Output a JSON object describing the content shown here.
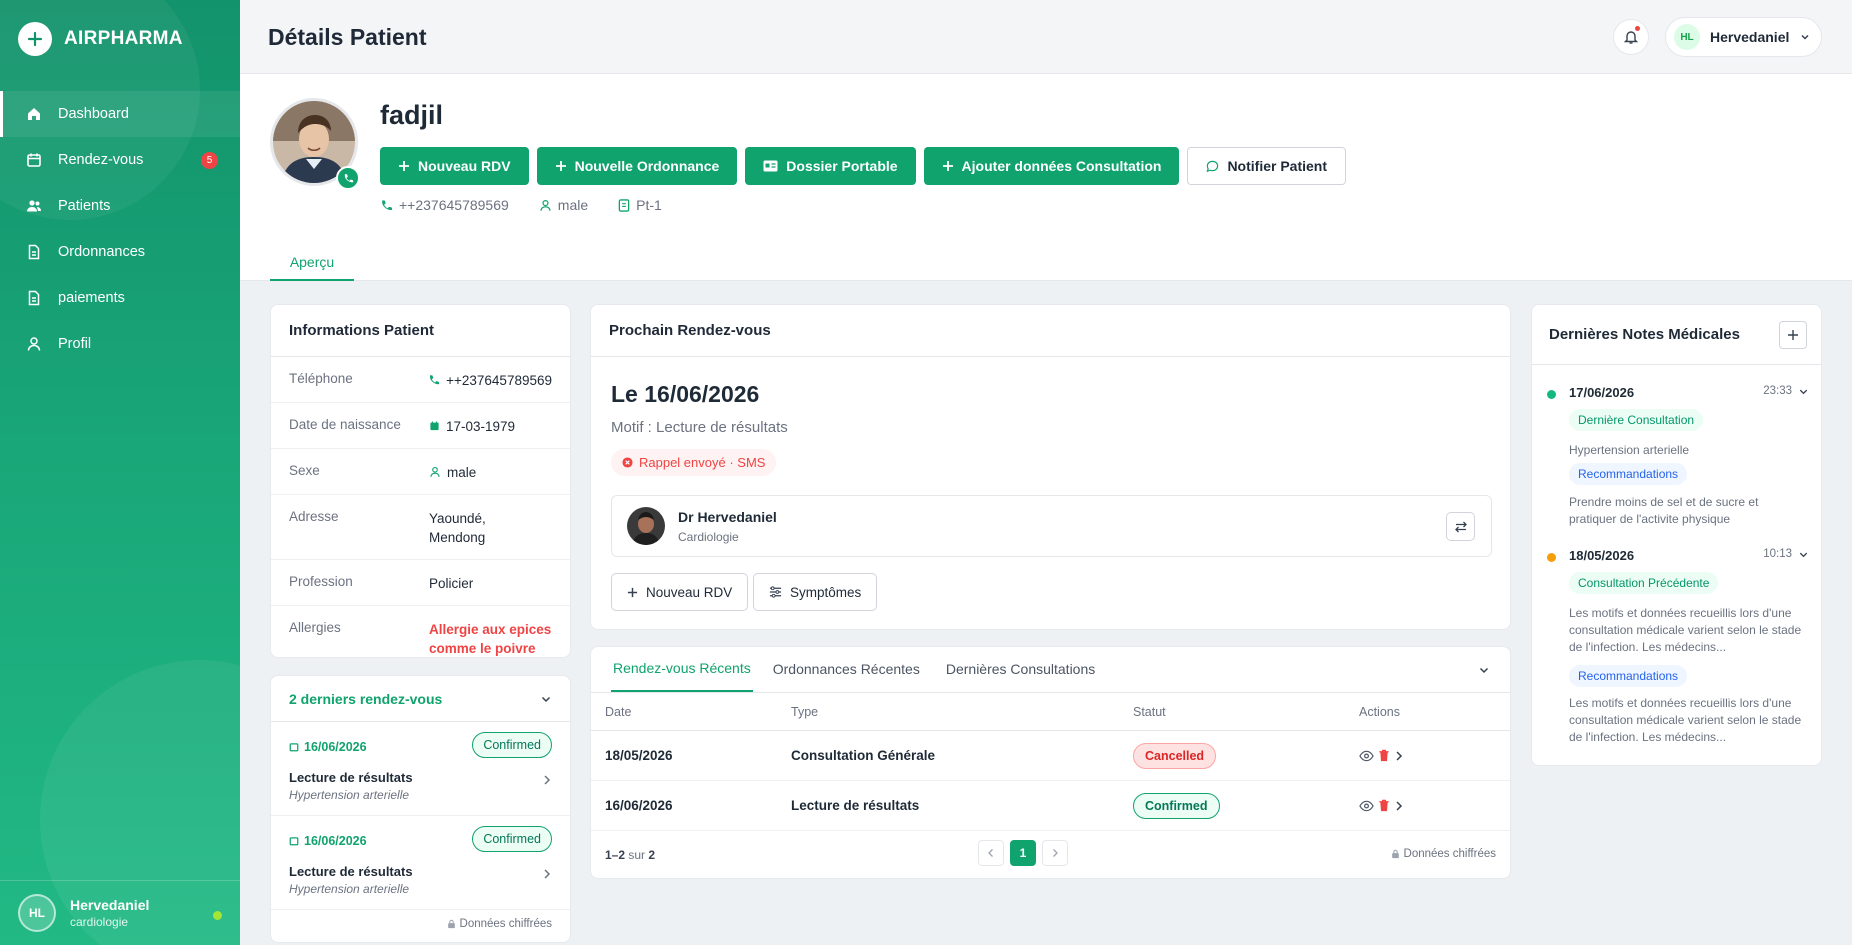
{
  "app": {
    "brand": "AIRPHARMA"
  },
  "sidebar": {
    "items": [
      {
        "label": "Dashboard",
        "icon": "home-icon"
      },
      {
        "label": "Rendez-vous",
        "icon": "calendar-icon",
        "badge": "5"
      },
      {
        "label": "Patients",
        "icon": "users-icon"
      },
      {
        "label": "Ordonnances",
        "icon": "file-icon"
      },
      {
        "label": "paiements",
        "icon": "file-icon"
      },
      {
        "label": "Profil",
        "icon": "user-icon"
      }
    ],
    "user": {
      "initials": "HL",
      "name": "Hervedaniel",
      "role": "cardiologie"
    }
  },
  "header": {
    "title": "Détails Patient",
    "user_initials": "HL",
    "user_name": "Hervedaniel"
  },
  "patient": {
    "name": "fadjil",
    "phone": "++237645789569",
    "sex": "male",
    "id": "Pt-1",
    "actions": [
      "Nouveau RDV",
      "Nouvelle Ordonnance",
      "Dossier Portable",
      "Ajouter données Consultation",
      "Notifier Patient"
    ],
    "tab": "Aperçu"
  },
  "info": {
    "title": "Informations Patient",
    "rows": [
      {
        "k": "Téléphone",
        "v": "++237645789569"
      },
      {
        "k": "Date de naissance",
        "v": "17-03-1979"
      },
      {
        "k": "Sexe",
        "v": "male"
      },
      {
        "k": "Adresse",
        "v": "Yaoundé, Mendong"
      },
      {
        "k": "Profession",
        "v": "Policier"
      },
      {
        "k": "Allergies",
        "v": "Allergie aux epices comme le poivre"
      }
    ]
  },
  "last_rdv": {
    "title": "2 derniers rendez-vous",
    "items": [
      {
        "date": "16/06/2026",
        "status": "Confirmed",
        "title": "Lecture de résultats",
        "sub": "Hypertension arterielle"
      },
      {
        "date": "16/06/2026",
        "status": "Confirmed",
        "title": "Lecture de résultats",
        "sub": "Hypertension arterielle"
      }
    ],
    "footer": "Données chiffrées"
  },
  "next_rdv": {
    "title": "Prochain Rendez-vous",
    "date": "Le 16/06/2026",
    "motif": "Motif : Lecture de résultats",
    "reminder": "Rappel envoyé · SMS",
    "doctor": "Dr Hervedaniel",
    "specialty": "Cardiologie",
    "btn_new": "Nouveau RDV",
    "btn_symptoms": "Symptômes"
  },
  "recent": {
    "tabs": [
      "Rendez-vous Récents",
      "Ordonnances Récentes",
      "Dernières Consultations"
    ],
    "columns": [
      "Date",
      "Type",
      "Statut",
      "Actions"
    ],
    "rows": [
      {
        "date": "18/05/2026",
        "type": "Consultation Générale",
        "status": "Cancelled"
      },
      {
        "date": "16/06/2026",
        "type": "Lecture de résultats",
        "status": "Confirmed"
      }
    ],
    "range": "1–2",
    "sur": "sur",
    "total": "2",
    "page": "1",
    "footer": "Données chiffrées"
  },
  "notes": {
    "title": "Dernières Notes Médicales",
    "items": [
      {
        "date": "17/06/2026",
        "time": "23:33",
        "dot": "#10b981",
        "tag": "Dernière Consultation",
        "text": "Hypertension arterielle",
        "rec_tag": "Recommandations",
        "rec": "Prendre moins de sel et de sucre et pratiquer de l'activite physique"
      },
      {
        "date": "18/05/2026",
        "time": "10:13",
        "dot": "#f59e0b",
        "tag": "Consultation Précédente",
        "text": "Les motifs et données recueillis lors d'une consultation médicale varient selon le stade de l'infection. Les médecins...",
        "rec_tag": "Recommandations",
        "rec": "Les motifs et données recueillis lors d'une consultation médicale varient selon le stade de l'infection. Les médecins..."
      }
    ]
  },
  "colors": {
    "accent": "#10a36e",
    "danger": "#ef4444"
  }
}
